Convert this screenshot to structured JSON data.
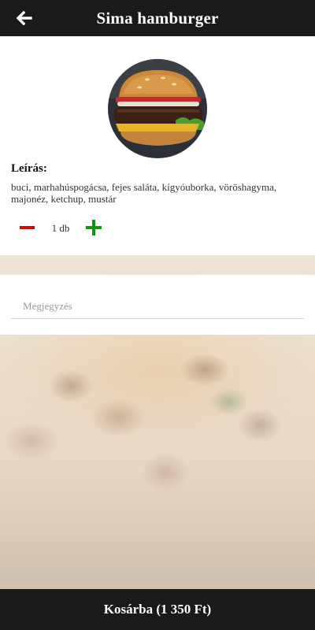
{
  "header": {
    "title": "Sima hamburger",
    "back_icon": "arrow-left-icon"
  },
  "product": {
    "image": "hamburger-photo",
    "description_label": "Leírás:",
    "description": "buci, marhahúspogácsa, fejes saláta, kígyóuborka, vöröshagyma, majonéz, ketchup, mustár",
    "quantity_label": "1 db",
    "quantity": 1,
    "decrease_icon": "minus-icon",
    "increase_icon": "plus-icon"
  },
  "note": {
    "placeholder": "Megjegyzés",
    "value": ""
  },
  "cart_button": {
    "label": "Kosárba (1 350 Ft)"
  },
  "colors": {
    "bar": "#1a1a1a",
    "minus": "#e00000",
    "plus": "#149214"
  }
}
